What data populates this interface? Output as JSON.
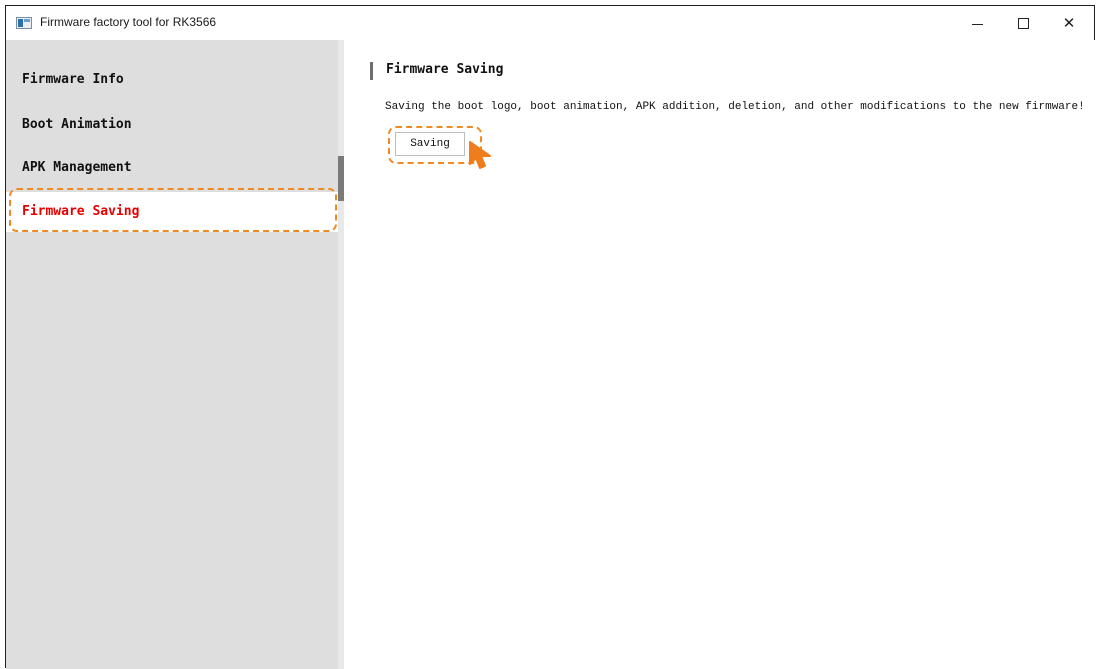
{
  "window": {
    "title": "Firmware factory tool for RK3566",
    "icons": {
      "app": "app-window-icon",
      "minimize": "minimize-icon",
      "maximize": "maximize-icon",
      "close": "close-icon"
    },
    "close_glyph": "✕"
  },
  "sidebar": {
    "items": [
      {
        "label": "Firmware Info",
        "active": false
      },
      {
        "label": "Boot Animation",
        "active": false
      },
      {
        "label": "APK Management",
        "active": false
      },
      {
        "label": "Firmware Saving",
        "active": true
      }
    ]
  },
  "main": {
    "section_title": "Firmware Saving",
    "description": "Saving the boot logo, boot animation, APK addition, deletion, and other modifications to the new firmware!",
    "save_button_label": "Saving"
  },
  "colors": {
    "accent_highlight": "#f08a24",
    "active_text": "#e60000",
    "sidebar_bg": "#dedede"
  }
}
